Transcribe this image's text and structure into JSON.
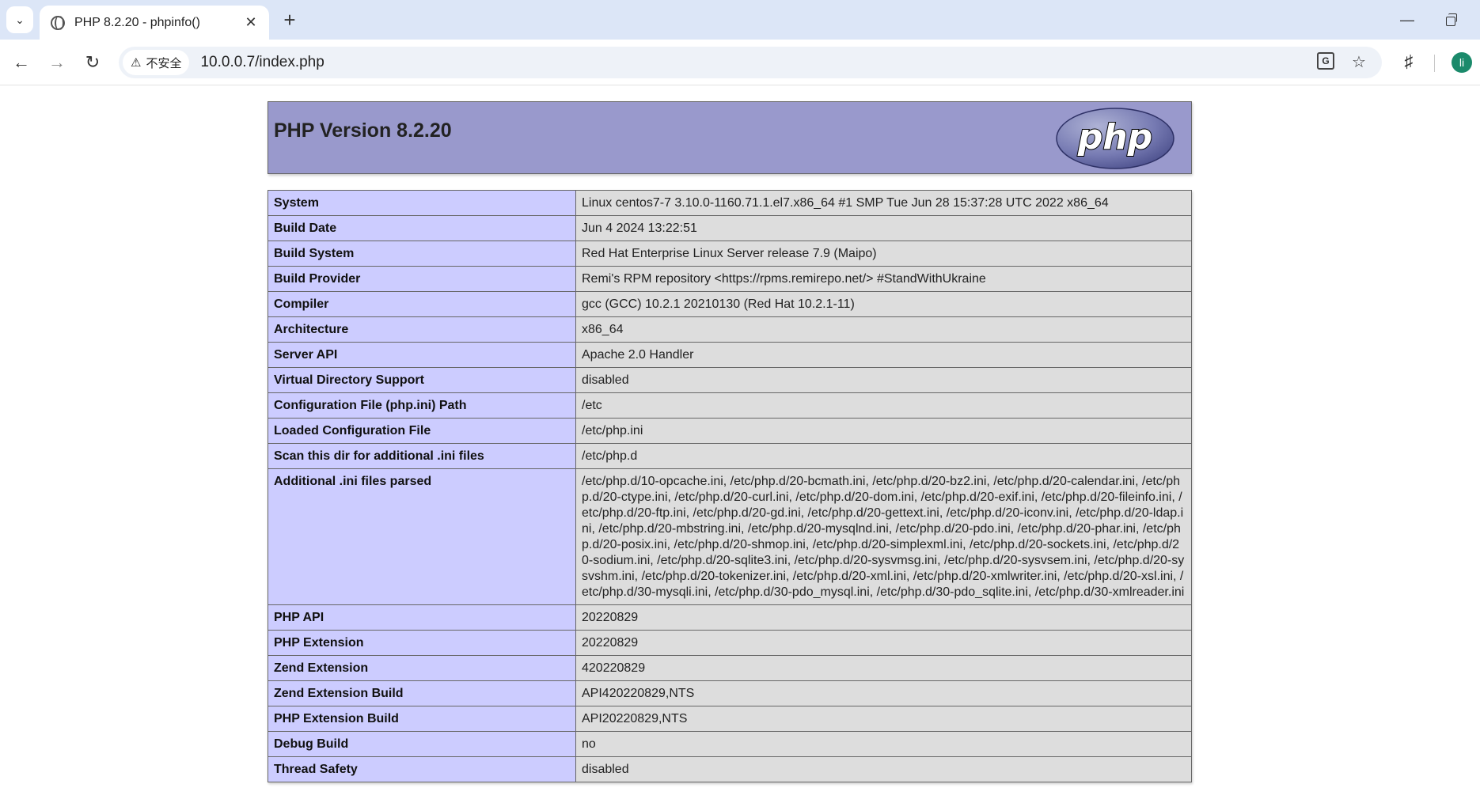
{
  "browser": {
    "tab_title": "PHP 8.2.20 - phpinfo()",
    "security_label": "不安全",
    "url": "10.0.0.7/index.php",
    "avatar_letter": "li"
  },
  "php": {
    "title": "PHP Version 8.2.20",
    "logo_text": "php",
    "rows": [
      {
        "key": "System",
        "value": "Linux centos7-7 3.10.0-1160.71.1.el7.x86_64 #1 SMP Tue Jun 28 15:37:28 UTC 2022 x86_64"
      },
      {
        "key": "Build Date",
        "value": "Jun 4 2024 13:22:51"
      },
      {
        "key": "Build System",
        "value": "Red Hat Enterprise Linux Server release 7.9 (Maipo)"
      },
      {
        "key": "Build Provider",
        "value": "Remi's RPM repository <https://rpms.remirepo.net/> #StandWithUkraine"
      },
      {
        "key": "Compiler",
        "value": "gcc (GCC) 10.2.1 20210130 (Red Hat 10.2.1-11)"
      },
      {
        "key": "Architecture",
        "value": "x86_64"
      },
      {
        "key": "Server API",
        "value": "Apache 2.0 Handler"
      },
      {
        "key": "Virtual Directory Support",
        "value": "disabled"
      },
      {
        "key": "Configuration File (php.ini) Path",
        "value": "/etc"
      },
      {
        "key": "Loaded Configuration File",
        "value": "/etc/php.ini"
      },
      {
        "key": "Scan this dir for additional .ini files",
        "value": "/etc/php.d"
      },
      {
        "key": "Additional .ini files parsed",
        "value": "/etc/php.d/10-opcache.ini, /etc/php.d/20-bcmath.ini, /etc/php.d/20-bz2.ini, /etc/php.d/20-calendar.ini, /etc/php.d/20-ctype.ini, /etc/php.d/20-curl.ini, /etc/php.d/20-dom.ini, /etc/php.d/20-exif.ini, /etc/php.d/20-fileinfo.ini, /etc/php.d/20-ftp.ini, /etc/php.d/20-gd.ini, /etc/php.d/20-gettext.ini, /etc/php.d/20-iconv.ini, /etc/php.d/20-ldap.ini, /etc/php.d/20-mbstring.ini, /etc/php.d/20-mysqlnd.ini, /etc/php.d/20-pdo.ini, /etc/php.d/20-phar.ini, /etc/php.d/20-posix.ini, /etc/php.d/20-shmop.ini, /etc/php.d/20-simplexml.ini, /etc/php.d/20-sockets.ini, /etc/php.d/20-sodium.ini, /etc/php.d/20-sqlite3.ini, /etc/php.d/20-sysvmsg.ini, /etc/php.d/20-sysvsem.ini, /etc/php.d/20-sysvshm.ini, /etc/php.d/20-tokenizer.ini, /etc/php.d/20-xml.ini, /etc/php.d/20-xmlwriter.ini, /etc/php.d/20-xsl.ini, /etc/php.d/30-mysqli.ini, /etc/php.d/30-pdo_mysql.ini, /etc/php.d/30-pdo_sqlite.ini, /etc/php.d/30-xmlreader.ini"
      },
      {
        "key": "PHP API",
        "value": "20220829"
      },
      {
        "key": "PHP Extension",
        "value": "20220829"
      },
      {
        "key": "Zend Extension",
        "value": "420220829"
      },
      {
        "key": "Zend Extension Build",
        "value": "API420220829,NTS"
      },
      {
        "key": "PHP Extension Build",
        "value": "API20220829,NTS"
      },
      {
        "key": "Debug Build",
        "value": "no"
      },
      {
        "key": "Thread Safety",
        "value": "disabled"
      }
    ]
  }
}
